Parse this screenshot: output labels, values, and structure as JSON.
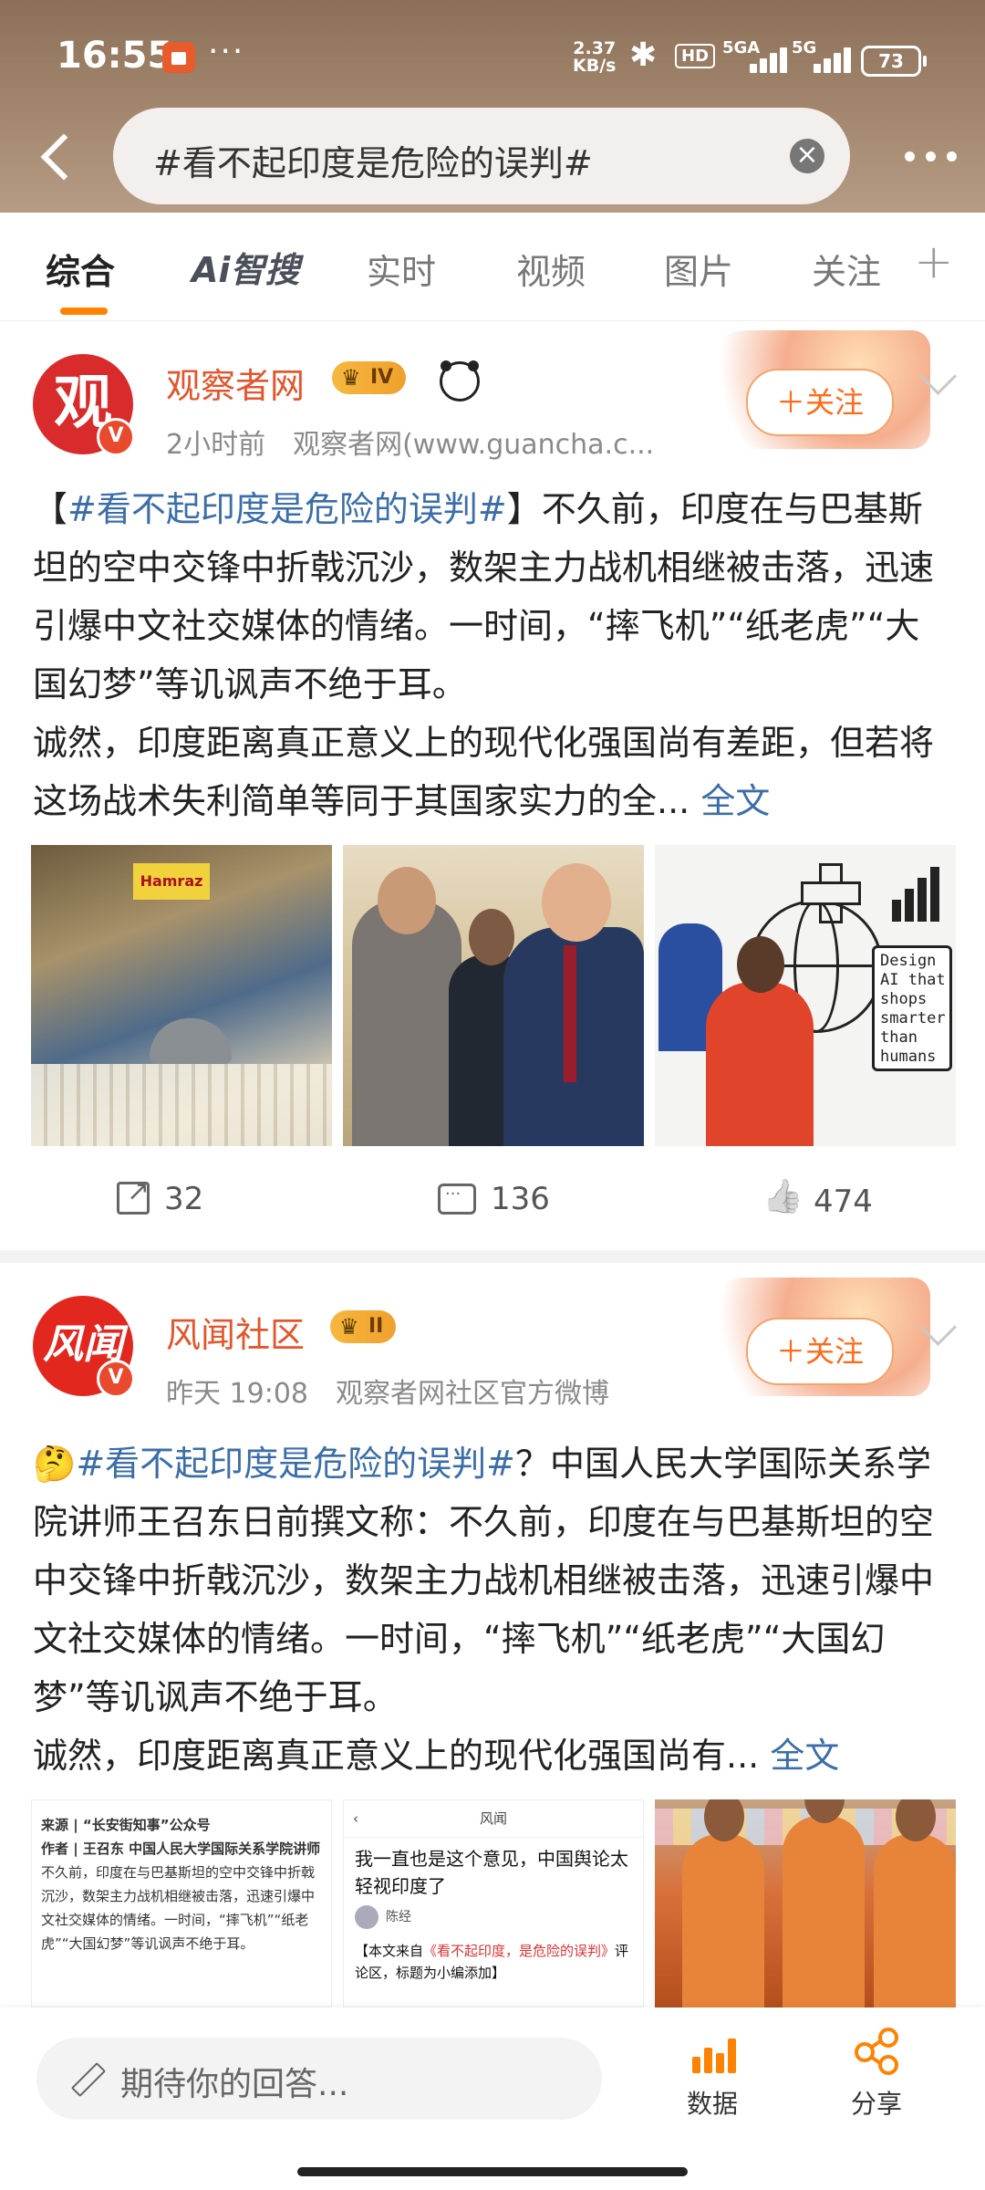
{
  "status_bar": {
    "time": "16:55",
    "speed_value": "2.37",
    "speed_unit": "KB/s",
    "hd": "HD",
    "net1": "5GA",
    "net2": "5G",
    "battery": "73"
  },
  "search": {
    "query": "#看不起印度是危险的误判#"
  },
  "tabs": [
    {
      "label": "综合",
      "active": true
    },
    {
      "label": "Ai智搜",
      "active": false
    },
    {
      "label": "实时",
      "active": false
    },
    {
      "label": "视频",
      "active": false
    },
    {
      "label": "图片",
      "active": false
    },
    {
      "label": "关注",
      "active": false
    }
  ],
  "posts": [
    {
      "author": "观察者网",
      "level": "IV",
      "time": "2小时前",
      "source": "观察者网(www.guancha.c...",
      "follow_label": "＋关注",
      "topic": "#看不起印度是危险的误判#",
      "text_open": "【",
      "text_close": "】",
      "text_1": "不久前，印度在与巴基斯坦的空中交锋中折戟沉沙，数架主力战机相继被击落，迅速引爆中文社交媒体的情绪。一时间，“摔飞机”“纸老虎”“大国幻梦”等讥讽声不绝于耳。",
      "text_2": "诚然，印度距离真正意义上的现代化强国尚有差距，但若将这场战术失利简单等同于其国家实力的全...",
      "more_label": "全文",
      "image3_text": "Design AI that shops smarter than humans",
      "reposts": "32",
      "comments": "136",
      "likes": "474"
    },
    {
      "author": "风闻社区",
      "level": "II",
      "time": "昨天 19:08",
      "source": "观察者网社区官方微博",
      "follow_label": "＋关注",
      "topic": "#看不起印度是危险的误判#",
      "emoji": "🤔",
      "text_1": "？中国人民大学国际关系学院讲师王召东日前撰文称：不久前，印度在与巴基斯坦的空中交锋中折戟沉沙，数架主力战机相继被击落，迅速引爆中文社交媒体的情绪。一时间，“摔飞机”“纸老虎”“大国幻梦”等讥讽声不绝于耳。",
      "text_2": "诚然，印度距离真正意义上的现代化强国尚有...",
      "more_label": "全文",
      "image1": {
        "source_line": "来源 | “长安街知事”公众号",
        "author_line": "作者 | 王召东 中国人民大学国际关系学院讲师",
        "body": "不久前，印度在与巴基斯坦的空中交锋中折戟沉沙，数架主力战机相继被击落，迅速引爆中文社交媒体的情绪。一时间，“摔飞机”“纸老虎”“大国幻梦”等讥讽声不绝于耳。"
      },
      "image2": {
        "header": "风闻",
        "title": "我一直也是这个意见，中国舆论太轻视印度了",
        "user": "陈经",
        "quote_pre": "【本文来自",
        "quote_link": "《看不起印度，是危险的误判》",
        "quote_post": "评论区，标题为小编添加】"
      }
    }
  ],
  "bottom_bar": {
    "reply_placeholder": "期待你的回答...",
    "data_label": "数据",
    "share_label": "分享"
  },
  "colors": {
    "accent": "#ff8200",
    "topic_link": "#3b6ea8",
    "author_name": "#e3552c"
  }
}
